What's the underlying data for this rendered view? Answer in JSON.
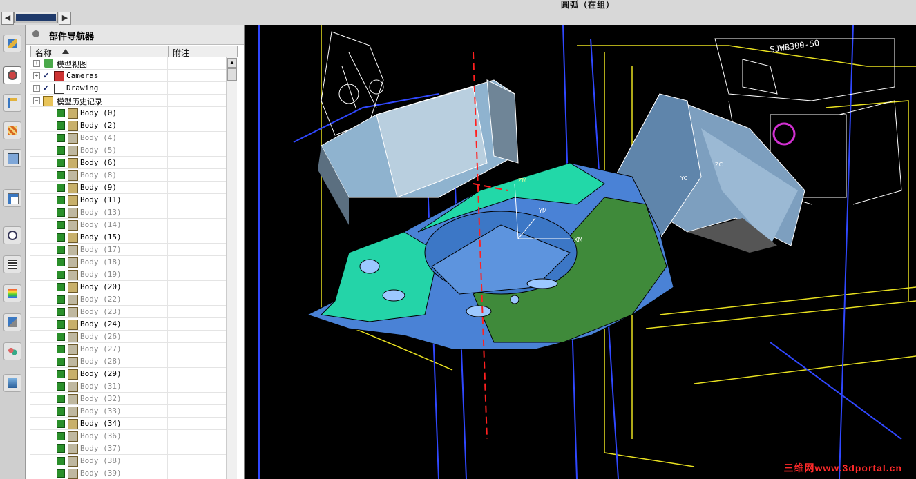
{
  "topbar": {
    "status_text": "圆弧（在组）",
    "nav_left": "◀",
    "nav_right": "▶"
  },
  "panel": {
    "title": "部件导航器",
    "columns": {
      "name": "名称",
      "note": "附注"
    }
  },
  "tree": {
    "model_views": "模型视图",
    "cameras": "Cameras",
    "drawing": "Drawing",
    "history": "模型历史记录",
    "bodies": [
      {
        "label": "Body (0)",
        "active": true
      },
      {
        "label": "Body (2)",
        "active": true
      },
      {
        "label": "Body (4)",
        "active": false
      },
      {
        "label": "Body (5)",
        "active": false
      },
      {
        "label": "Body (6)",
        "active": true
      },
      {
        "label": "Body (8)",
        "active": false
      },
      {
        "label": "Body (9)",
        "active": true
      },
      {
        "label": "Body (11)",
        "active": true
      },
      {
        "label": "Body (13)",
        "active": false
      },
      {
        "label": "Body (14)",
        "active": false
      },
      {
        "label": "Body (15)",
        "active": true
      },
      {
        "label": "Body (17)",
        "active": false
      },
      {
        "label": "Body (18)",
        "active": false
      },
      {
        "label": "Body (19)",
        "active": false
      },
      {
        "label": "Body (20)",
        "active": true
      },
      {
        "label": "Body (22)",
        "active": false
      },
      {
        "label": "Body (23)",
        "active": false
      },
      {
        "label": "Body (24)",
        "active": true
      },
      {
        "label": "Body (26)",
        "active": false
      },
      {
        "label": "Body (27)",
        "active": false
      },
      {
        "label": "Body (28)",
        "active": false
      },
      {
        "label": "Body (29)",
        "active": true
      },
      {
        "label": "Body (31)",
        "active": false
      },
      {
        "label": "Body (32)",
        "active": false
      },
      {
        "label": "Body (33)",
        "active": false
      },
      {
        "label": "Body (34)",
        "active": true
      },
      {
        "label": "Body (36)",
        "active": false
      },
      {
        "label": "Body (37)",
        "active": false
      },
      {
        "label": "Body (38)",
        "active": false
      },
      {
        "label": "Body (39)",
        "active": false
      }
    ]
  },
  "viewport": {
    "axis_labels": {
      "zm": "ZM",
      "ym": "YM",
      "xm": "XM",
      "zc": "ZC",
      "yc": "YC"
    },
    "drawing_text": "SJWB300-50",
    "watermark": "三维网www.3dportal.cn"
  },
  "toolbar_icons": [
    "assembly-navigator-icon",
    "part-navigator-icon",
    "constraint-navigator-icon",
    "reuse-library-icon",
    "history-icon",
    "web-browser-icon",
    "clock-icon",
    "process-navigator-icon",
    "color-analysis-icon",
    "tooling-icon",
    "roles-icon",
    "display-palette-icon"
  ],
  "colors": {
    "panel_bg": "#ffffff",
    "viewport_bg": "#000000",
    "accent": "#1f3a6b"
  }
}
